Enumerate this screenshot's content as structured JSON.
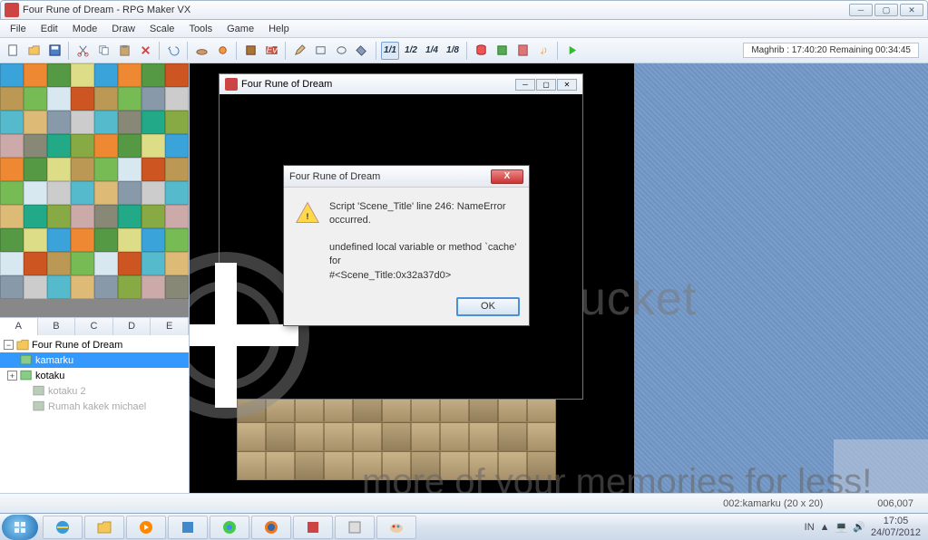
{
  "window": {
    "title": "Four Rune of Dream - RPG Maker VX"
  },
  "menu": {
    "items": [
      "File",
      "Edit",
      "Mode",
      "Draw",
      "Scale",
      "Tools",
      "Game",
      "Help"
    ]
  },
  "fractions": [
    "1/1",
    "1/2",
    "1/4",
    "1/8"
  ],
  "prayer": {
    "text": "Maghrib : 17:40:20  Remaining 00:34:45"
  },
  "tabs": [
    "A",
    "B",
    "C",
    "D",
    "E"
  ],
  "tree": {
    "root": "Four Rune of Dream",
    "items": [
      {
        "label": "kamarku",
        "sel": true,
        "indent": 1
      },
      {
        "label": "kotaku",
        "sel": false,
        "indent": 1,
        "exp": "+"
      },
      {
        "label": "kotaku 2",
        "sel": false,
        "indent": 2
      },
      {
        "label": "Rumah kakek michael",
        "sel": false,
        "indent": 2
      }
    ]
  },
  "gamewin": {
    "title": "Four Rune of Dream"
  },
  "error": {
    "title": "Four Rune of Dream",
    "line1": "Script 'Scene_Title' line 246: NameError occurred.",
    "line2": "undefined local variable or method `cache' for",
    "line3": "#<Scene_Title:0x32a37d0>",
    "ok": "OK"
  },
  "status": {
    "map": "002:kamarku (20 x 20)",
    "coord": "006,007"
  },
  "tray": {
    "lang": "IN",
    "time": "17:05",
    "date": "24/07/2012"
  },
  "watermark": {
    "w2": "ucket",
    "w3": "more of your memories for less!"
  }
}
